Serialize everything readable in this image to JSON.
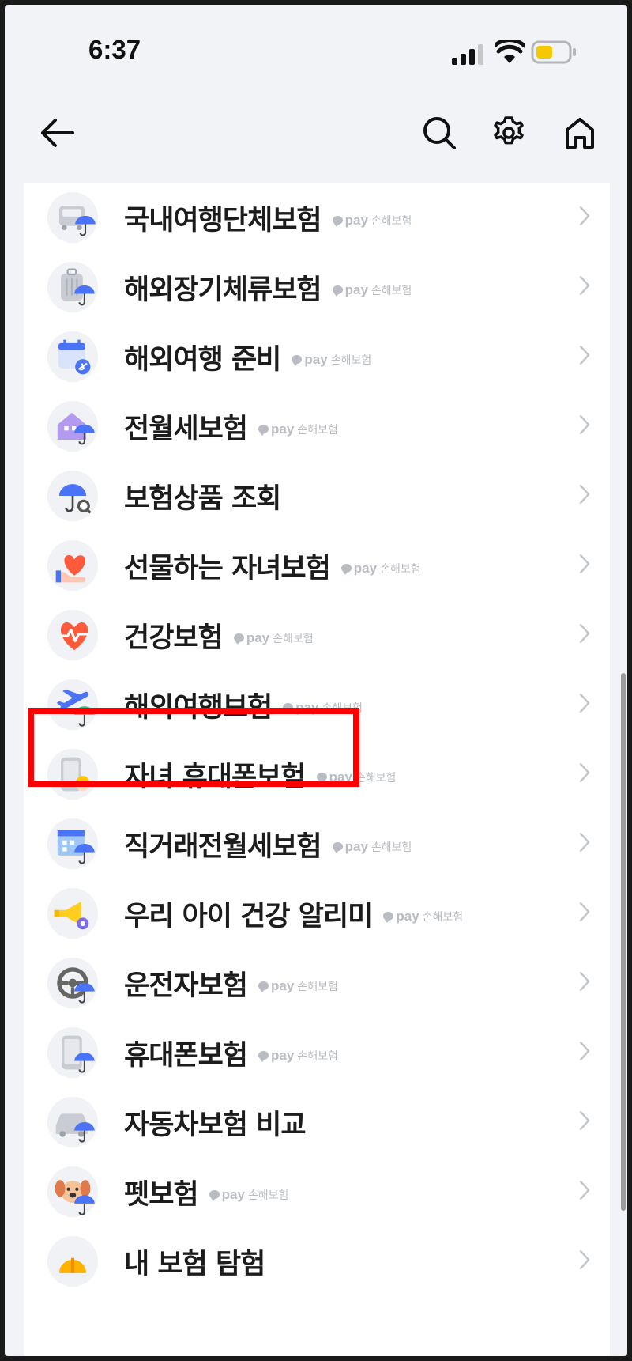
{
  "status": {
    "time": "6:37"
  },
  "nav": {
    "back_icon": "arrow-left-icon",
    "search_icon": "search-icon",
    "settings_icon": "gear-icon",
    "home_icon": "home-icon"
  },
  "badge": {
    "pay": "pay",
    "insurance": "손해보험"
  },
  "items": [
    {
      "label": "국내여행단체보험",
      "badge": true,
      "icon": "bus-umbrella-icon"
    },
    {
      "label": "해외장기체류보험",
      "badge": true,
      "icon": "luggage-umbrella-icon"
    },
    {
      "label": "해외여행 준비",
      "badge": true,
      "icon": "calendar-plane-icon"
    },
    {
      "label": "전월세보험",
      "badge": true,
      "icon": "house-umbrella-icon"
    },
    {
      "label": "보험상품 조회",
      "badge": false,
      "icon": "umbrella-search-icon"
    },
    {
      "label": "선물하는 자녀보험",
      "badge": true,
      "icon": "heart-hand-icon"
    },
    {
      "label": "건강보험",
      "badge": true,
      "icon": "heartbeat-icon"
    },
    {
      "label": "해외여행보험",
      "badge": true,
      "icon": "airplane-umbrella-icon"
    },
    {
      "label": "자녀 휴대폰보험",
      "badge": true,
      "icon": "phone-child-icon"
    },
    {
      "label": "직거래전월세보험",
      "badge": true,
      "icon": "building-umbrella-icon"
    },
    {
      "label": "우리 아이 건강 알리미",
      "badge": true,
      "icon": "megaphone-icon"
    },
    {
      "label": "운전자보험",
      "badge": true,
      "icon": "steering-wheel-icon"
    },
    {
      "label": "휴대폰보험",
      "badge": true,
      "icon": "phone-umbrella-icon"
    },
    {
      "label": "자동차보험 비교",
      "badge": false,
      "icon": "car-umbrella-icon"
    },
    {
      "label": "펫보험",
      "badge": true,
      "icon": "dog-umbrella-icon"
    },
    {
      "label": "내 보험 탐험",
      "badge": false,
      "icon": "helmet-icon"
    }
  ],
  "colors": {
    "background": "#f2f3f6",
    "card": "#ffffff",
    "highlight": "#ff0000",
    "umbrella_blue": "#4a74f5",
    "badge_gray": "#b9bcc2"
  }
}
